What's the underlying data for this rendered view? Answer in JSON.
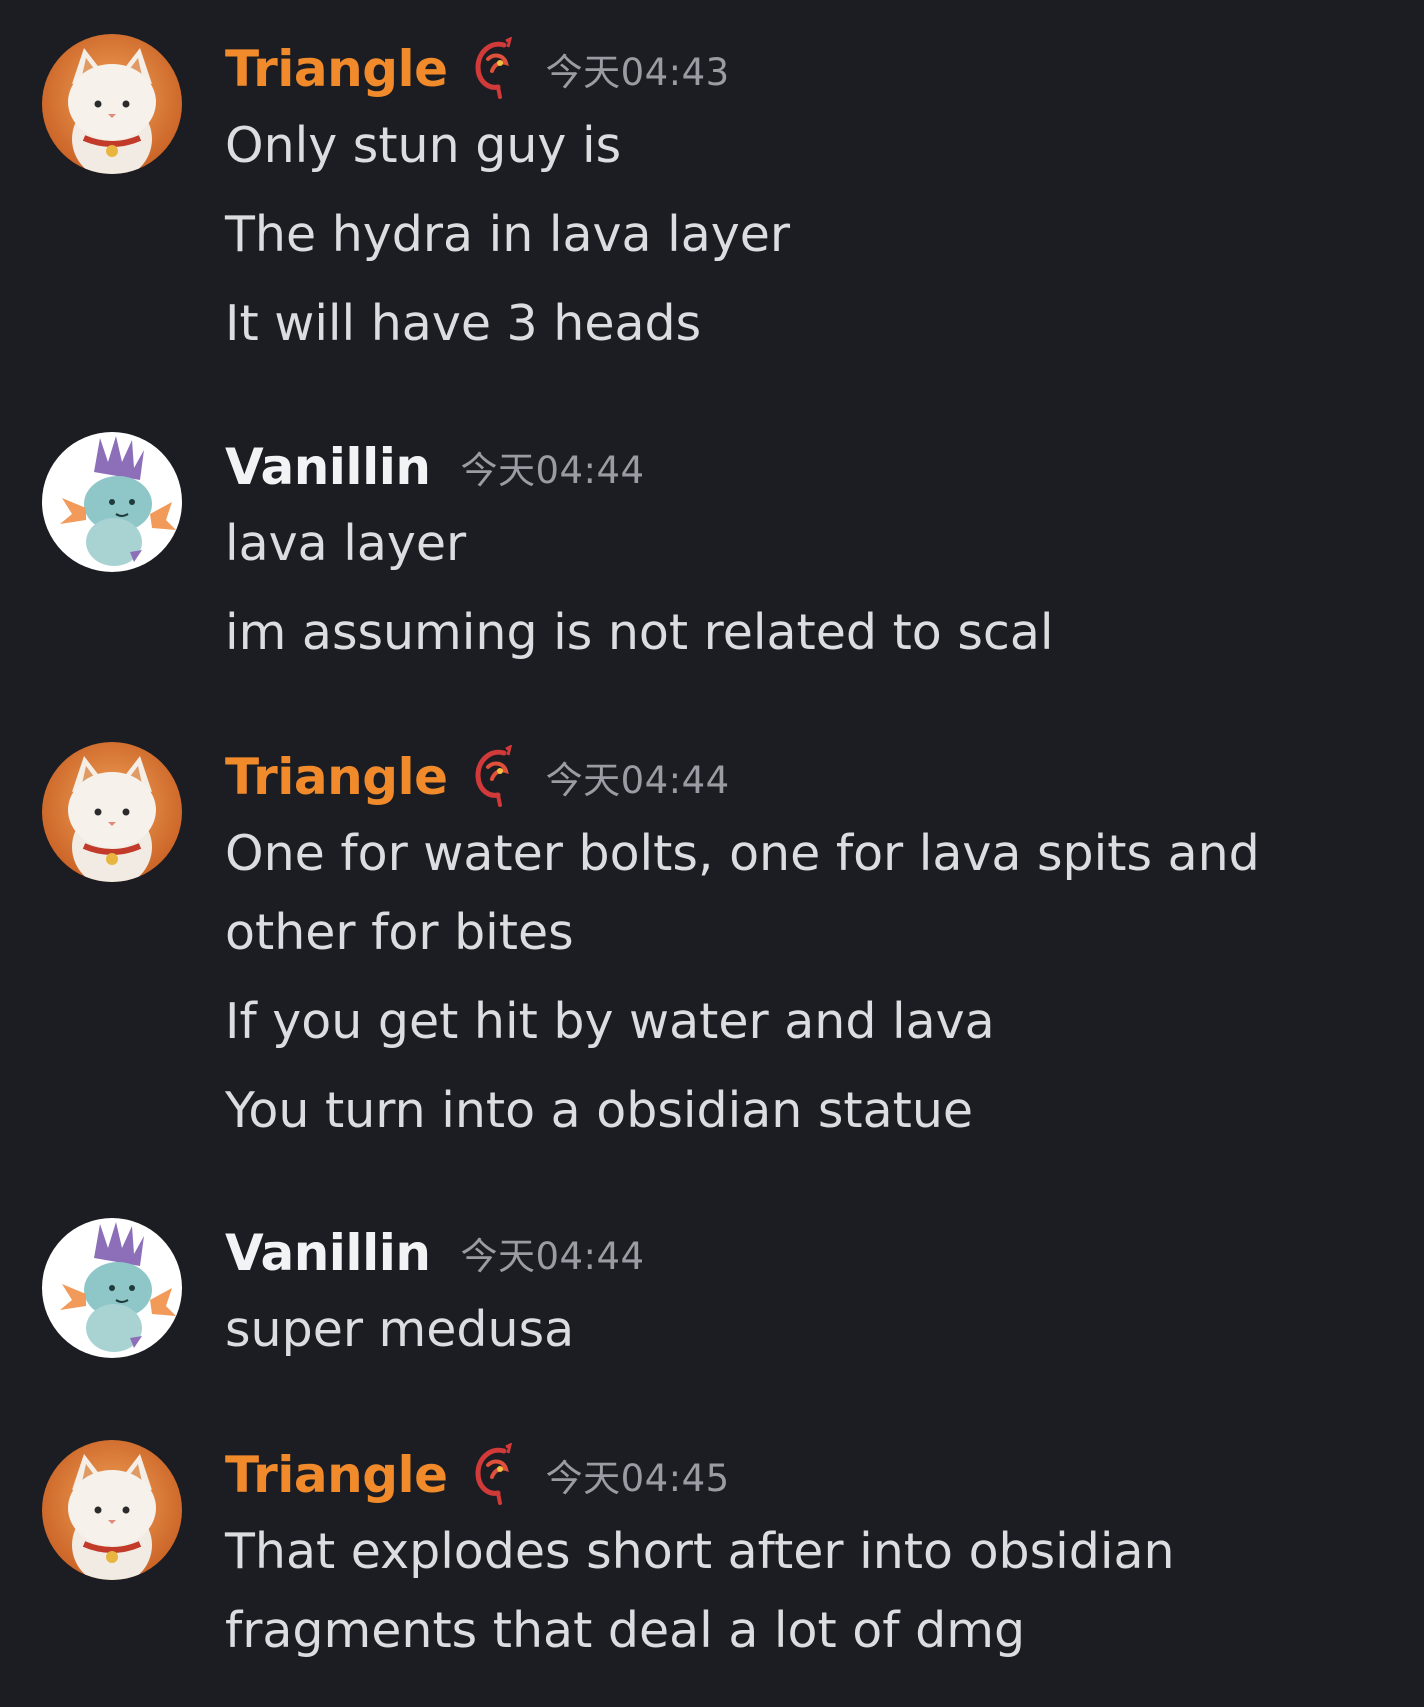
{
  "colors": {
    "background": "#1c1d22",
    "triangle_name": "#f08a2a",
    "vanillin_name": "#f2f3f5",
    "message_text": "#dcdde0",
    "timestamp": "#9a9ca3"
  },
  "messages": [
    {
      "author": "Triangle",
      "avatar_icon": "white-cat-avatar-icon",
      "badge_icon": "red-dragon-badge-icon",
      "timestamp": "今天04:43",
      "lines": [
        "Only stun guy is",
        "The hydra in lava layer",
        "It will have 3 heads"
      ]
    },
    {
      "author": "Vanillin",
      "avatar_icon": "blue-fish-creature-avatar-icon",
      "timestamp": "今天04:44",
      "lines": [
        "lava layer",
        "im assuming is not related to scal"
      ]
    },
    {
      "author": "Triangle",
      "avatar_icon": "white-cat-avatar-icon",
      "badge_icon": "red-dragon-badge-icon",
      "timestamp": "今天04:44",
      "lines": [
        "One for water bolts, one for lava spits and other for bites",
        "If you get hit by water and lava",
        "You turn into a obsidian statue"
      ]
    },
    {
      "author": "Vanillin",
      "avatar_icon": "blue-fish-creature-avatar-icon",
      "timestamp": "今天04:44",
      "lines": [
        "super medusa"
      ]
    },
    {
      "author": "Triangle",
      "avatar_icon": "white-cat-avatar-icon",
      "badge_icon": "red-dragon-badge-icon",
      "timestamp": "今天04:45",
      "lines": [
        "That explodes short after into obsidian fragments that deal a lot of dmg"
      ]
    }
  ]
}
